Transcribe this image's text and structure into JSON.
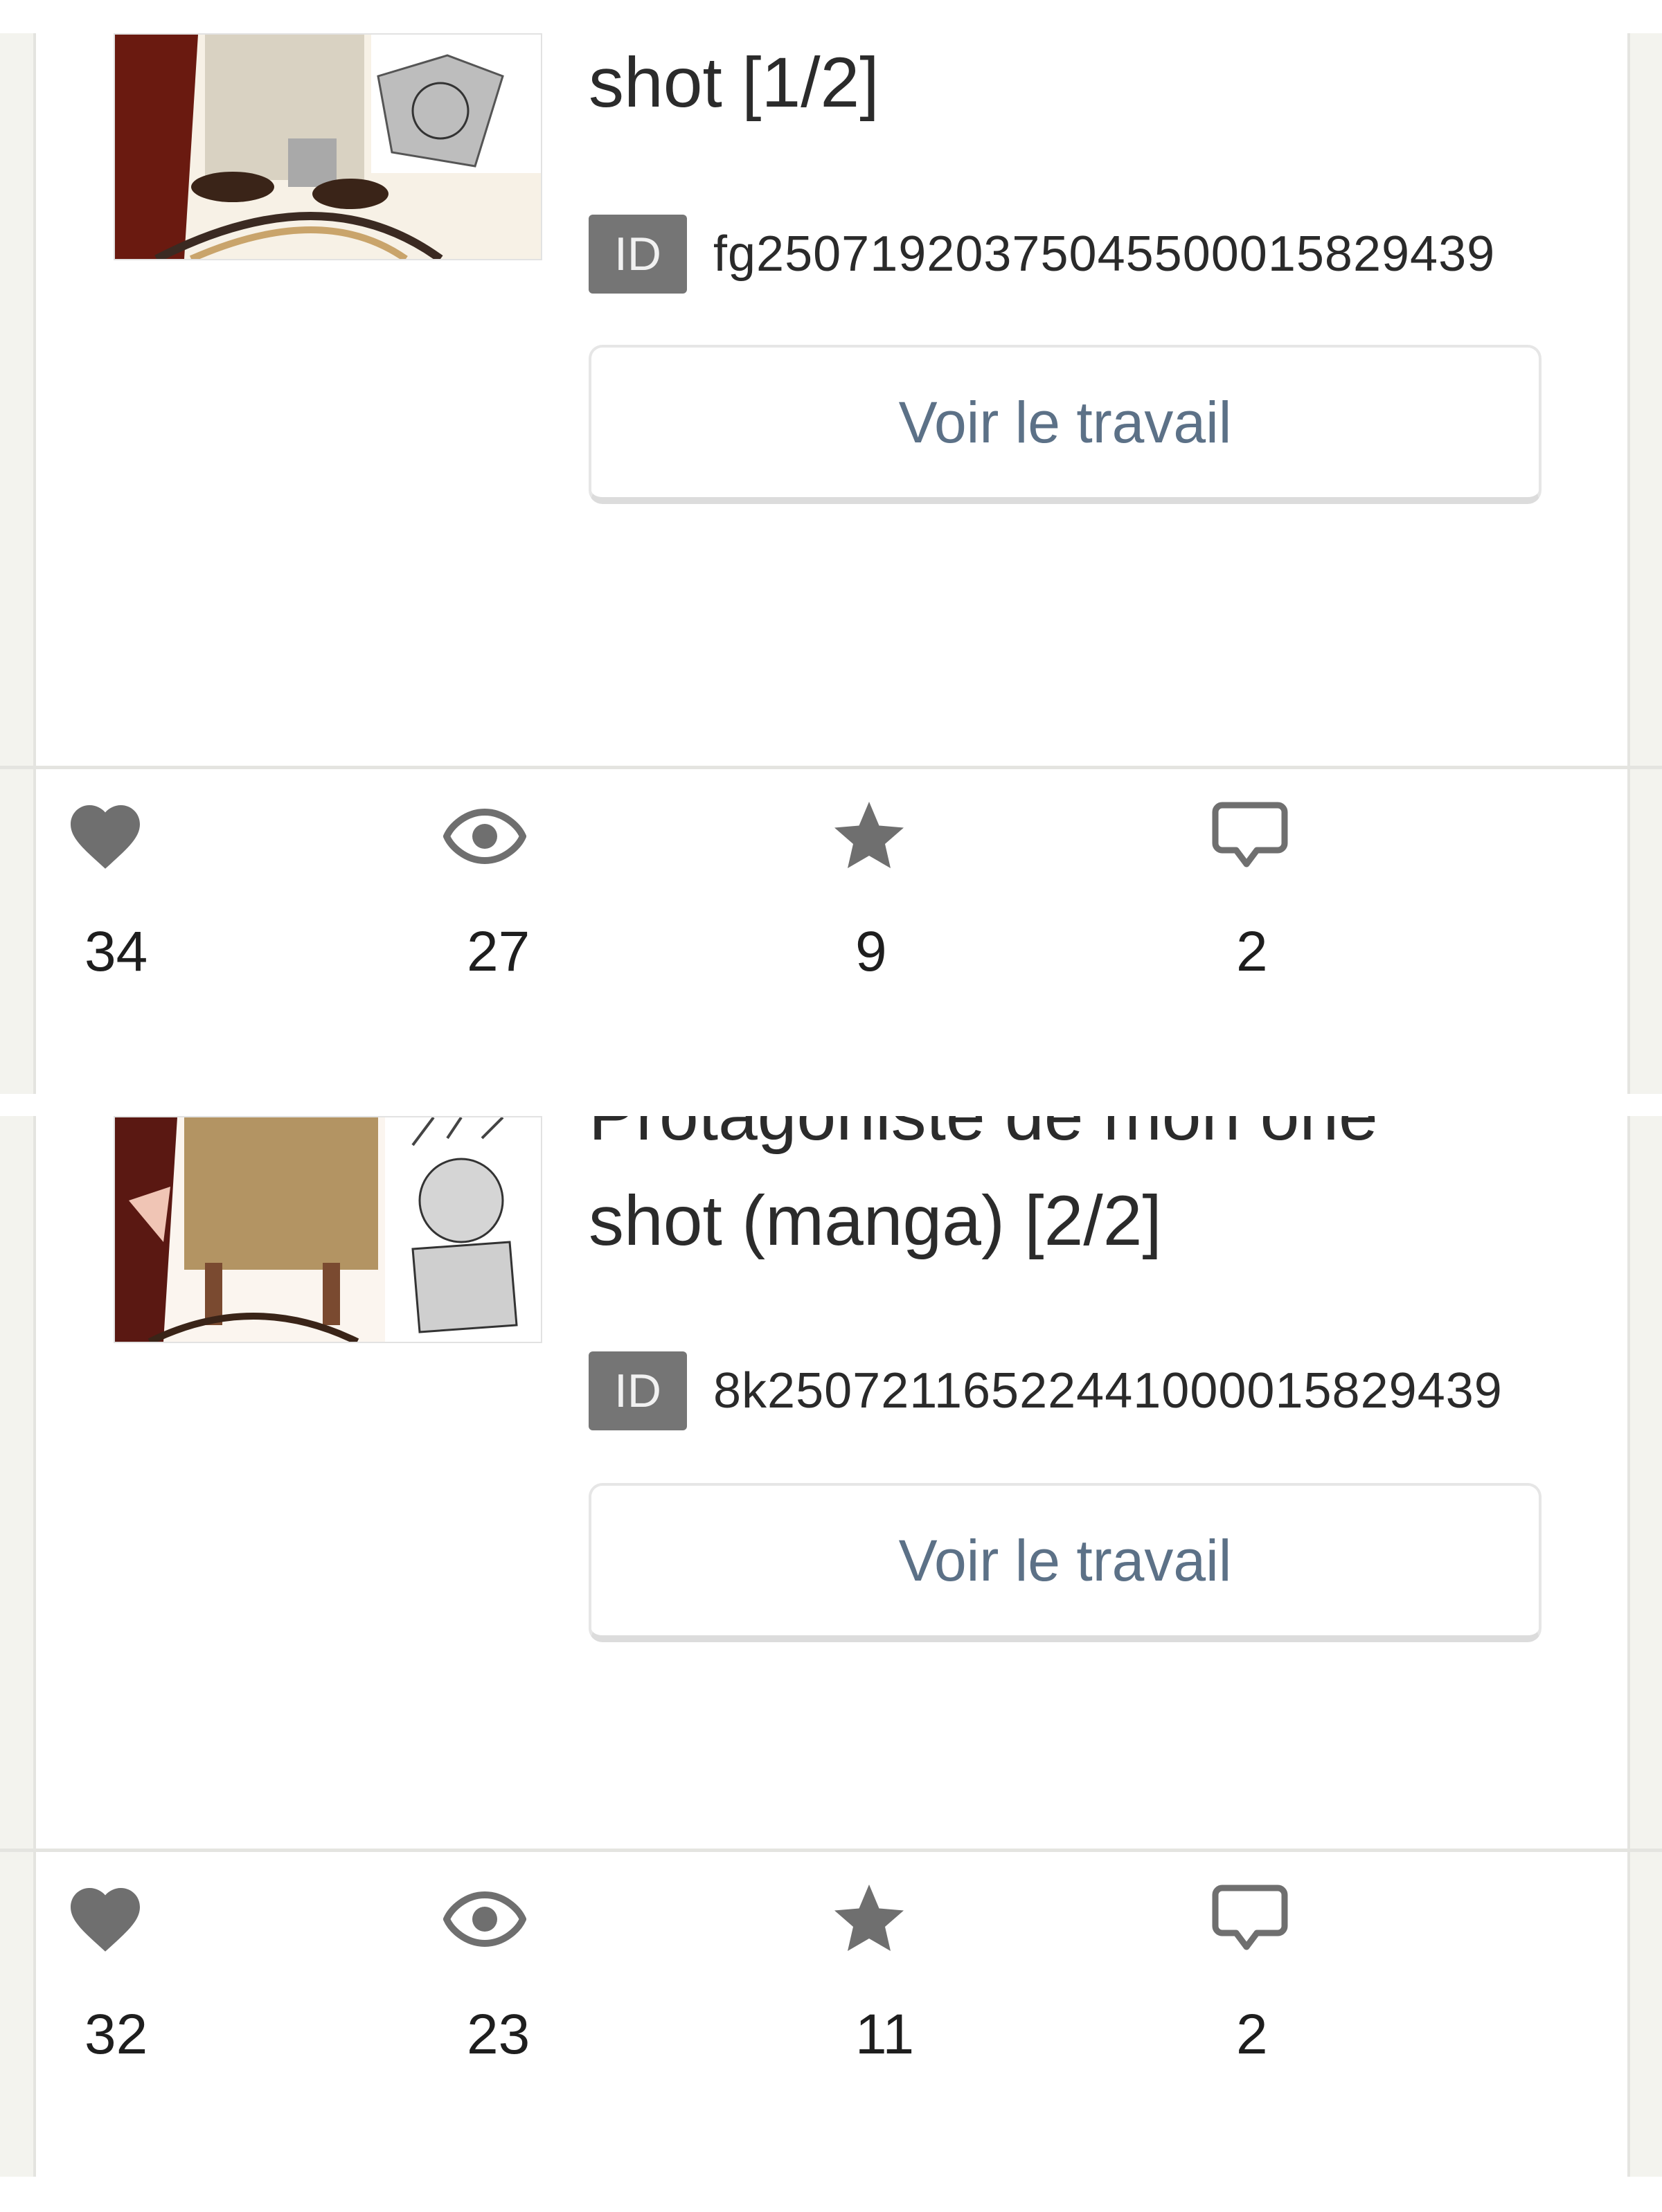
{
  "posts": [
    {
      "title": "shot [1/2]",
      "title_clipped_line": "",
      "id_label": "ID",
      "id_value": "fg25071920375045500015829439",
      "button_label": "Voir le travail",
      "stats": {
        "likes": "34",
        "views": "27",
        "stars": "9",
        "comments": "2"
      }
    },
    {
      "title": "shot (manga) [2/2]",
      "title_clipped_line": "Protagoniste de mon one",
      "id_label": "ID",
      "id_value": "8k25072116522441000015829439",
      "button_label": "Voir le travail",
      "stats": {
        "likes": "32",
        "views": "23",
        "stars": "11",
        "comments": "2"
      }
    }
  ],
  "icons": {
    "like": "heart-icon",
    "view": "eye-icon",
    "star": "star-icon",
    "comment": "speech-bubble-icon"
  },
  "colors": {
    "icon_gray": "#6f6f6f",
    "badge_gray": "#757575",
    "button_text": "#5c7187",
    "side_panel": "#f3f3ee"
  }
}
